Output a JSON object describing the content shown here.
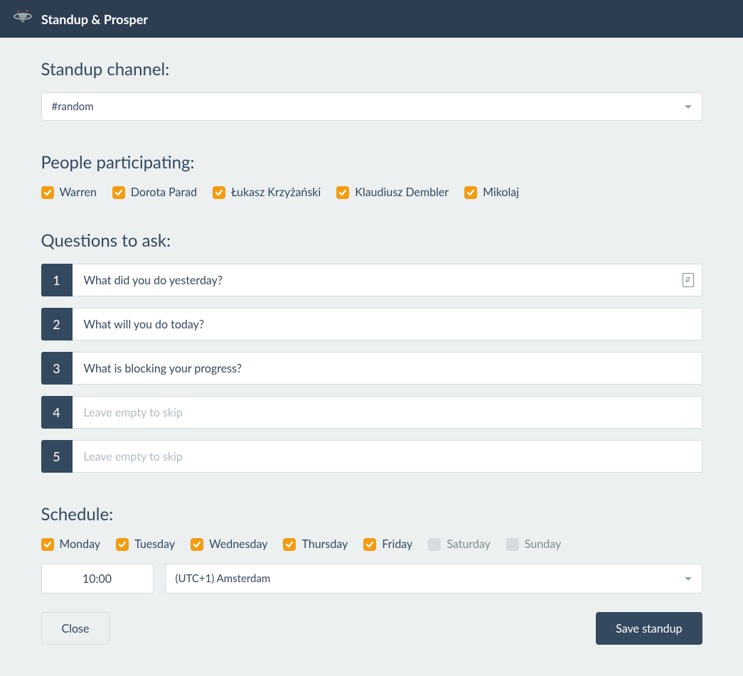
{
  "app": {
    "title": "Standup & Prosper"
  },
  "channel": {
    "label": "Standup channel:",
    "value": "#random"
  },
  "people": {
    "label": "People participating:",
    "items": [
      {
        "name": "Warren",
        "checked": true
      },
      {
        "name": "Dorota Parad",
        "checked": true
      },
      {
        "name": "Łukasz Krzyżański",
        "checked": true
      },
      {
        "name": "Klaudiusz Dembler",
        "checked": true
      },
      {
        "name": "Mikolaj",
        "checked": true
      }
    ]
  },
  "questions": {
    "label": "Questions to ask:",
    "placeholder": "Leave empty to skip",
    "items": [
      {
        "num": "1",
        "value": "What did you do yesterday?"
      },
      {
        "num": "2",
        "value": "What will you do today?"
      },
      {
        "num": "3",
        "value": "What is blocking your progress?"
      },
      {
        "num": "4",
        "value": ""
      },
      {
        "num": "5",
        "value": ""
      }
    ]
  },
  "schedule": {
    "label": "Schedule:",
    "days": [
      {
        "name": "Monday",
        "checked": true
      },
      {
        "name": "Tuesday",
        "checked": true
      },
      {
        "name": "Wednesday",
        "checked": true
      },
      {
        "name": "Thursday",
        "checked": true
      },
      {
        "name": "Friday",
        "checked": true
      },
      {
        "name": "Saturday",
        "checked": false
      },
      {
        "name": "Sunday",
        "checked": false
      }
    ],
    "time": "10:00",
    "timezone": "(UTC+1) Amsterdam"
  },
  "buttons": {
    "close": "Close",
    "save": "Save standup"
  }
}
